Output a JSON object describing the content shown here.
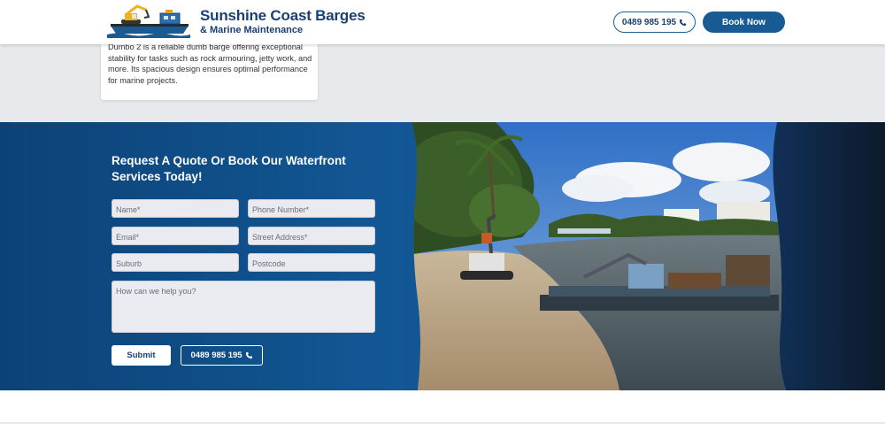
{
  "header": {
    "brand_name": "Sunshine Coast Barges",
    "brand_sub": "& Marine Maintenance",
    "phone": "0489 985 195",
    "book_label": "Book Now"
  },
  "card": {
    "text": "Dumbo 2 is a reliable dumb barge offering exceptional stability for tasks such as rock armouring, jetty work, and more. Its spacious design ensures optimal performance for marine projects."
  },
  "quote": {
    "heading": "Request A Quote Or Book Our Waterfront Services Today!",
    "fields": {
      "name": "Name*",
      "phone": "Phone Number*",
      "email": "Email*",
      "street": "Street Address*",
      "suburb": "Suburb",
      "postcode": "Postcode",
      "message": "How can we help you?"
    },
    "submit_label": "Submit",
    "phone": "0489 985 195"
  },
  "colors": {
    "brand": "#1a3f74",
    "button": "#175a94",
    "section_blue": "#125896"
  },
  "icons": [
    "barge-excavator-logo-icon",
    "phone-icon"
  ]
}
